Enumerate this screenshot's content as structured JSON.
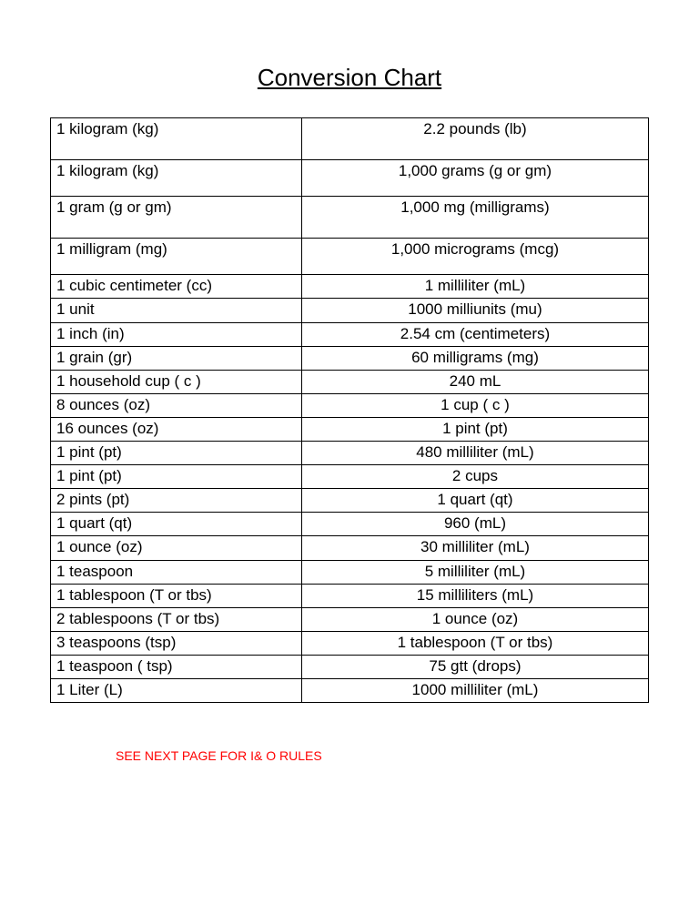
{
  "title": "Conversion Chart",
  "rows": [
    {
      "left": "1 kilogram (kg)",
      "right": "2.2 pounds (lb)",
      "cls": "tall"
    },
    {
      "left": "1 kilogram (kg)",
      "right": "1,000 grams (g or gm)",
      "cls": "med"
    },
    {
      "left": "1 gram (g or gm)",
      "right": "1,000 mg (milligrams)",
      "cls": "tall"
    },
    {
      "left": "1 milligram (mg)",
      "right": "1,000 micrograms (mcg)",
      "cls": "med"
    },
    {
      "left": "1 cubic centimeter (cc)",
      "right": "1 milliliter (mL)",
      "cls": ""
    },
    {
      "left": "1 unit",
      "right": "1000 milliunits (mu)",
      "cls": ""
    },
    {
      "left": "1 inch (in)",
      "right": "2.54 cm (centimeters)",
      "cls": ""
    },
    {
      "left": "1 grain (gr)",
      "right": "60 milligrams (mg)",
      "cls": ""
    },
    {
      "left": "1 household cup ( c )",
      "right": "240 mL",
      "cls": ""
    },
    {
      "left": "8 ounces (oz)",
      "right": "1 cup ( c )",
      "cls": ""
    },
    {
      "left": "16 ounces (oz)",
      "right": "1 pint (pt)",
      "cls": ""
    },
    {
      "left": "1 pint (pt)",
      "right": "480 milliliter (mL)",
      "cls": ""
    },
    {
      "left": "1 pint (pt)",
      "right": "2 cups",
      "cls": ""
    },
    {
      "left": "2 pints (pt)",
      "right": "1 quart (qt)",
      "cls": ""
    },
    {
      "left": "1 quart (qt)",
      "right": "960 (mL)",
      "cls": ""
    },
    {
      "left": "1 ounce (oz)",
      "right": "30 milliliter (mL)",
      "cls": ""
    },
    {
      "left": "1 teaspoon",
      "right": "5 milliliter (mL)",
      "cls": ""
    },
    {
      "left": "1 tablespoon (T or tbs)",
      "right": "15 milliliters (mL)",
      "cls": ""
    },
    {
      "left": "2 tablespoons (T or tbs)",
      "right": "1 ounce (oz)",
      "cls": ""
    },
    {
      "left": "3 teaspoons (tsp)",
      "right": "1 tablespoon (T or tbs)",
      "cls": ""
    },
    {
      "left": "1 teaspoon ( tsp)",
      "right": "75 gtt (drops)",
      "cls": ""
    },
    {
      "left": "1 Liter (L)",
      "right": "1000 milliliter  (mL)",
      "cls": ""
    }
  ],
  "note": "SEE NEXT PAGE FOR I& O RULES"
}
